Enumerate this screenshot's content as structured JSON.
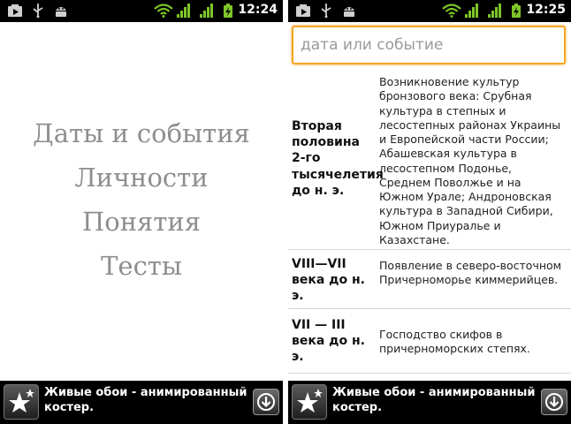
{
  "left_screen": {
    "status_time": "12:24",
    "menu": [
      "Даты и события",
      "Личности",
      "Понятия",
      "Тесты"
    ],
    "ad_text": "Живые обои - анимированный костер."
  },
  "right_screen": {
    "status_time": "12:25",
    "search": {
      "placeholder": "дата или событие",
      "value": ""
    },
    "events": [
      {
        "date": "Вторая половина 2-го тысячелетия до н. э.",
        "text": "Возникновение культур бронзового века: Срубная культура в степных и лесостепных районах Украины и Европейской части России; Абашевская культура в лесостепном Подонье, Среднем Поволжье и на Южном Урале; Андроновская культура в Западной Сибири, Южном Приуралье и Казахстане."
      },
      {
        "date": "VIII—VII века до н. э.",
        "text": "Появление в северо-восточном Причерноморье киммерийцев."
      },
      {
        "date": "VII — III века до н. э.",
        "text": "Господство скифов в причерноморских степях."
      }
    ],
    "ad_text": "Живые обои - анимированный костер."
  },
  "colors": {
    "accent": "#f5a623",
    "menu_text": "#8e8e8e",
    "wifi_green": "#7ec528",
    "divider": "#d6d6d6"
  },
  "status_icons": [
    "media-icon",
    "usb-icon",
    "android-debug-icon",
    "wifi-icon",
    "signal-icon",
    "signal-icon",
    "battery-charging-icon"
  ]
}
